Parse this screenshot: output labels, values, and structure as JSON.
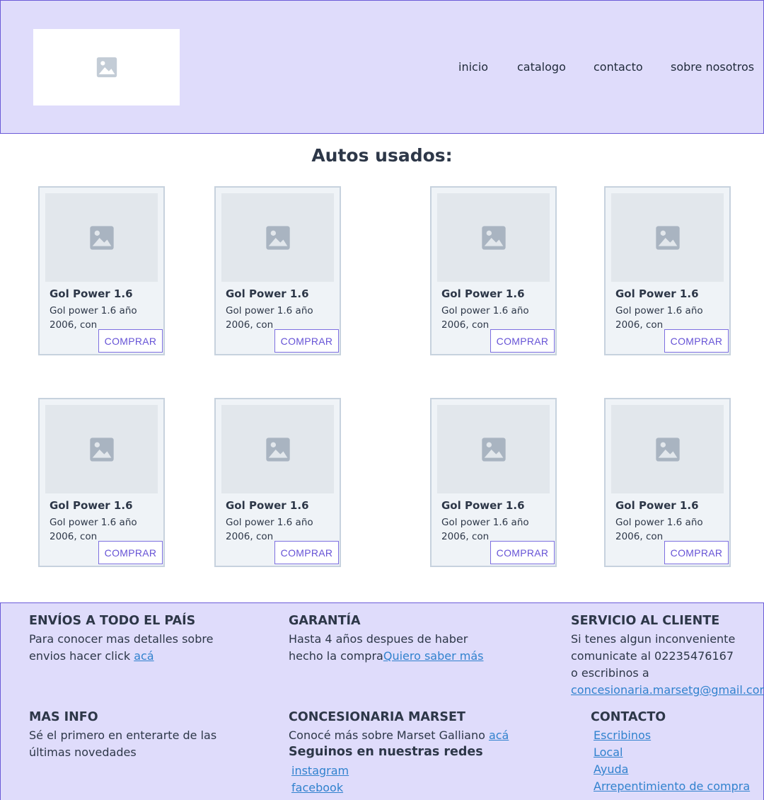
{
  "header": {
    "logo_icon": "image-placeholder-icon",
    "nav": [
      "inicio",
      "catalogo",
      "contacto",
      "sobre nosotros"
    ]
  },
  "main": {
    "title": "Autos usados:",
    "cards": [
      {
        "title": "Gol Power 1.6",
        "description": "Gol power 1.6 año 2006, con",
        "button": "COMPRAR"
      },
      {
        "title": "Gol Power 1.6",
        "description": "Gol power 1.6 año 2006, con",
        "button": "COMPRAR"
      },
      {
        "title": "Gol Power 1.6",
        "description": "Gol power 1.6 año 2006, con",
        "button": "COMPRAR"
      },
      {
        "title": "Gol Power 1.6",
        "description": "Gol power 1.6 año 2006, con",
        "button": "COMPRAR"
      },
      {
        "title": "Gol Power 1.6",
        "description": "Gol power 1.6 año 2006, con",
        "button": "COMPRAR"
      },
      {
        "title": "Gol Power 1.6",
        "description": "Gol power 1.6 año 2006, con",
        "button": "COMPRAR"
      },
      {
        "title": "Gol Power 1.6",
        "description": "Gol power 1.6 año 2006, con",
        "button": "COMPRAR"
      },
      {
        "title": "Gol Power 1.6",
        "description": "Gol power 1.6 año 2006, con",
        "button": "COMPRAR"
      }
    ]
  },
  "footer": {
    "shipping": {
      "heading": "ENVÍOS A TODO EL PAÍS",
      "text": "Para conocer mas detalles sobre envios hacer click ",
      "link": "acá"
    },
    "warranty": {
      "heading": "GARANTÍA",
      "text": "Hasta 4 años despues de haber hecho la compra",
      "link": "Quiero saber más"
    },
    "service": {
      "heading": "SERVICIO AL CLIENTE",
      "line1": "Si tenes algun inconveniente",
      "line2": "comunicate al 02235476167",
      "line3": "o escribinos a",
      "email": "concesionaria.marsetg@gmail.com"
    },
    "more_info": {
      "heading": "MAS INFO",
      "text": "Sé el primero en enterarte de las últimas novedades"
    },
    "dealer": {
      "heading": "CONCESIONARIA MARSET",
      "text": "Conocé más sobre Marset Galliano ",
      "link": "acá",
      "social_heading": "Seguinos en nuestras redes",
      "social": [
        "instagram",
        "facebook"
      ]
    },
    "contact": {
      "heading": "CONTACTO",
      "links": [
        "Escribinos",
        "Local",
        "Ayuda",
        "Arrepentimiento de compra"
      ]
    }
  },
  "colors": {
    "header_bg": "#dfdcfb",
    "border_accent": "#6b5bd8",
    "button_text": "#6653d6",
    "link": "#3182ce"
  }
}
